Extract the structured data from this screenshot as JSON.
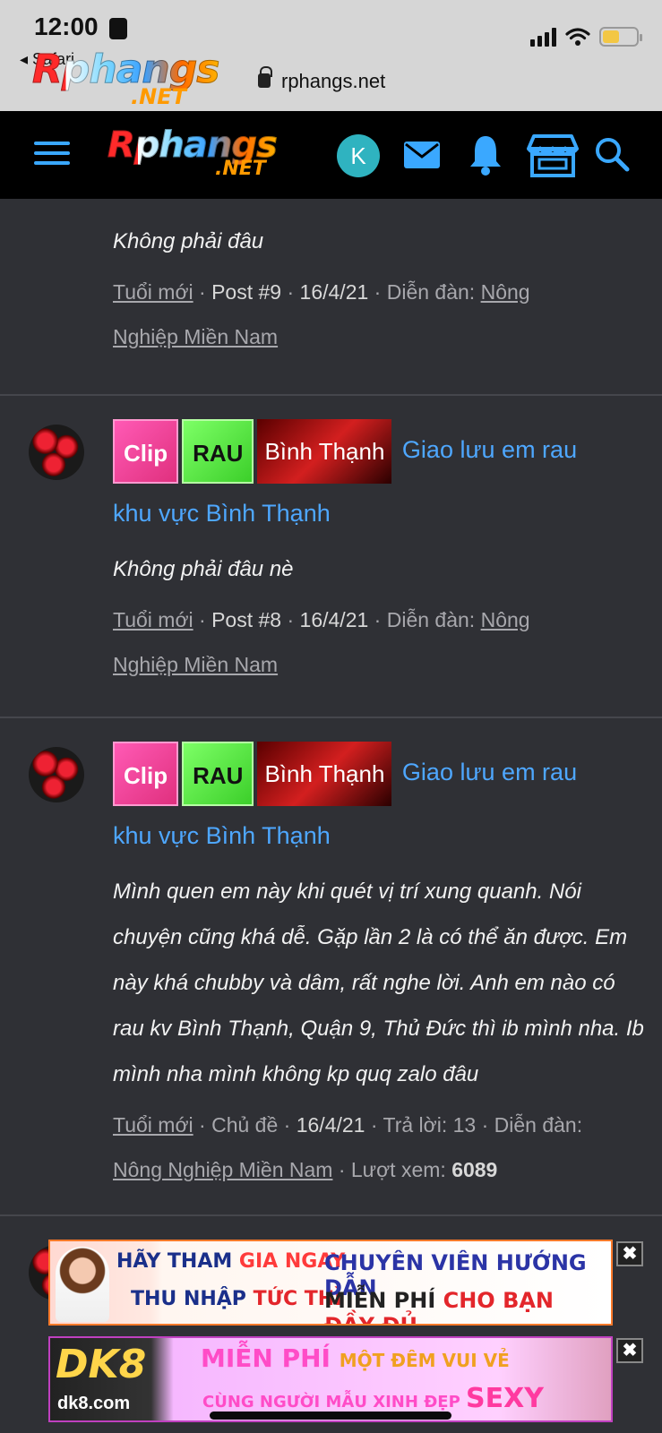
{
  "status": {
    "time": "12:00",
    "back_label": "◂ Safari",
    "url": "rphangs.net"
  },
  "brand": {
    "name": "Rphangs",
    "tld": ".NET"
  },
  "header": {
    "user_initial": "K"
  },
  "posts": [
    {
      "snippet": "Không phải đâu",
      "author": "Tuổi mới",
      "sep1": " · ",
      "kind": "Post #9",
      "sep2": " · ",
      "date": "16/4/21",
      "forum_prefix": " · Diễn đàn: ",
      "forum_line1": "Nông",
      "forum_line2": "Nghiệp Miền Nam"
    },
    {
      "tag_clip": "Clip",
      "tag_rau": "RAU",
      "tag_bt": "Bình Thạnh",
      "title_a": " Giao lưu em rau",
      "title_b": "khu vực Bình Thạnh",
      "snippet": "Không phải đâu nè",
      "author": "Tuổi mới",
      "sep1": " · ",
      "kind": "Post #8",
      "sep2": " · ",
      "date": "16/4/21",
      "forum_prefix": " · Diễn đàn: ",
      "forum_line1": "Nông",
      "forum_line2": "Nghiệp Miền Nam"
    },
    {
      "tag_clip": "Clip",
      "tag_rau": "RAU",
      "tag_bt": "Bình Thạnh",
      "title_a": " Giao lưu em rau",
      "title_b": "khu vực Bình Thạnh",
      "snippet": "Mình quen em này khi quét vị trí xung quanh. Nói chuyện cũng khá dễ. Gặp lần 2 là có thể ăn được. Em này khá chubby và dâm, rất nghe lời. Anh em nào có rau kv Bình Thạnh, Quận 9, Thủ Đức thì ib mình nha. Ib mình nha mình không kp quq zalo đâu",
      "author": "Tuổi mới",
      "sep1": " · ",
      "kind": "Chủ đề",
      "sep2": " · ",
      "date": "16/4/21",
      "replies": " · Trả lời: 13 · Diễn đàn:",
      "forum": "Nông Nghiệp Miền Nam",
      "views_label": " · Lượt xem: ",
      "views": "6089"
    }
  ],
  "ads": [
    {
      "line1_a": "HÃY THAM ",
      "line1_b": "GIA NGAY",
      "line2_a": "THU NHẬP ",
      "line2_b": "TỨC THÌ",
      "right1": "CHUYÊN VIÊN HƯỚNG DẪN",
      "right2_a": "MIỄN PHÍ ",
      "right2_b": "CHO BẠN ĐẦY ĐỦ",
      "close": "✖"
    },
    {
      "brand": "DK8",
      "domain": "dk8.com",
      "line1_a": "MIỄN PHÍ ",
      "line1_b": "MỘT ĐÊM VUI VẺ",
      "line2_a": "CÙNG NGƯỜI MẪU XINH ĐẸP ",
      "line2_b": "SEXY",
      "close": "✖"
    }
  ]
}
